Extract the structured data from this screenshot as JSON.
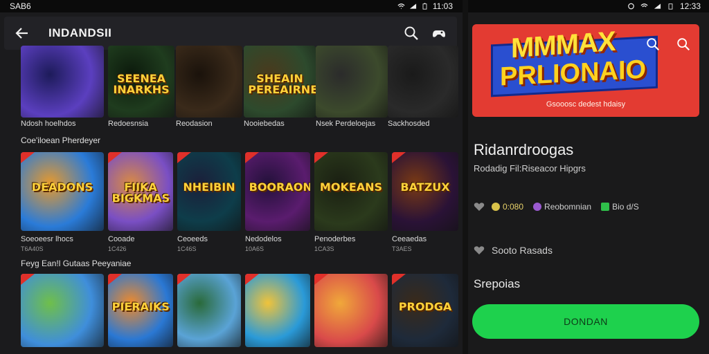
{
  "status_left": {
    "carrier": "SAB6",
    "time": "11:03"
  },
  "status_right": {
    "time": "12:33"
  },
  "appbar": {
    "title": "INDANDSII"
  },
  "featured": [
    {
      "caption": "Ndosh hoelhdos",
      "sub": "",
      "logo": "",
      "c1": "#5b3fbf",
      "c2": "#1d1b5a"
    },
    {
      "caption": "Redoesnsia",
      "sub": "",
      "logo": "SEENEA INARKHS",
      "c1": "#1f3c1e",
      "c2": "#0c1a0c"
    },
    {
      "caption": "Reodasion",
      "sub": "",
      "logo": "",
      "c1": "#3a2a1a",
      "c2": "#1a120b"
    },
    {
      "caption": "Nooiebedas",
      "sub": "",
      "logo": "SHEAIN PEREAIRNEDS",
      "c1": "#2d4a2d",
      "c2": "#4a3a1d"
    },
    {
      "caption": "Nsek Perdeloejas",
      "sub": "",
      "logo": "",
      "c1": "#3c4a2c",
      "c2": "#2b2b2b"
    },
    {
      "caption": "Sackhosded",
      "sub": "",
      "logo": "",
      "c1": "#2a2a2a",
      "c2": "#1a1a1a"
    }
  ],
  "section1": {
    "title": "Coe'iloean Pherdeyer"
  },
  "row1": [
    {
      "caption": "Soeoeesr lhocs",
      "sub": "T6A40S",
      "logo": "DEADONS",
      "c1": "#2a7bd8",
      "c2": "#e7992c"
    },
    {
      "caption": "Cooade",
      "sub": "1C426",
      "logo": "FIIKA BIGKMAS",
      "c1": "#7a4fc4",
      "c2": "#d98a43"
    },
    {
      "caption": "Ceoeeds",
      "sub": "1C46S",
      "logo": "NHEIBIN",
      "c1": "#0e3d4a",
      "c2": "#1b1f3a"
    },
    {
      "caption": "Nedodelos",
      "sub": "10A6S",
      "logo": "BOORAON",
      "c1": "#5a1c6e",
      "c2": "#23113a"
    },
    {
      "caption": "Penoderbes",
      "sub": "1CA3S",
      "logo": "MOKEANS",
      "c1": "#2b3a1c",
      "c2": "#1a1f12"
    },
    {
      "caption": "Ceeaedas",
      "sub": "T3AES",
      "logo": "BATZUX",
      "c1": "#2a1236",
      "c2": "#7a3a14"
    }
  ],
  "section2": {
    "title": "Feyg Ean!l Gutaas Peeyaniae"
  },
  "row2": [
    {
      "caption": "",
      "sub": "",
      "logo": "",
      "c1": "#3f8edb",
      "c2": "#6fbf4a"
    },
    {
      "caption": "",
      "sub": "",
      "logo": "PIERAIKS",
      "c1": "#2a78d4",
      "c2": "#f08a2a"
    },
    {
      "caption": "",
      "sub": "",
      "logo": "",
      "c1": "#5aa3d6",
      "c2": "#2a6a3a"
    },
    {
      "caption": "",
      "sub": "",
      "logo": "",
      "c1": "#2a9ad8",
      "c2": "#f0c33a"
    },
    {
      "caption": "",
      "sub": "",
      "logo": "",
      "c1": "#d94a4a",
      "c2": "#f0a83a"
    },
    {
      "caption": "",
      "sub": "",
      "logo": "PRODGA",
      "c1": "#1e2a3a",
      "c2": "#3a2a1a"
    }
  ],
  "promo": {
    "line1": "MMMAX",
    "line2": "PRLIONAIO",
    "tagline": "Gsooosc dedest hdaisy"
  },
  "details": {
    "title": "Ridanrdroogas",
    "subtitle": "Rodadig Fil:Riseacor Hipgrs",
    "rating": "0:080",
    "genre": "Reobomnian",
    "size": "Bio d/S",
    "wishlist": "Sooto Rasads",
    "section": "Srepoias",
    "button": "DONDAN"
  },
  "colors": {
    "accent_green": "#1ed14d",
    "promo_red": "#e33b32",
    "badge_red": "#e0302a"
  }
}
